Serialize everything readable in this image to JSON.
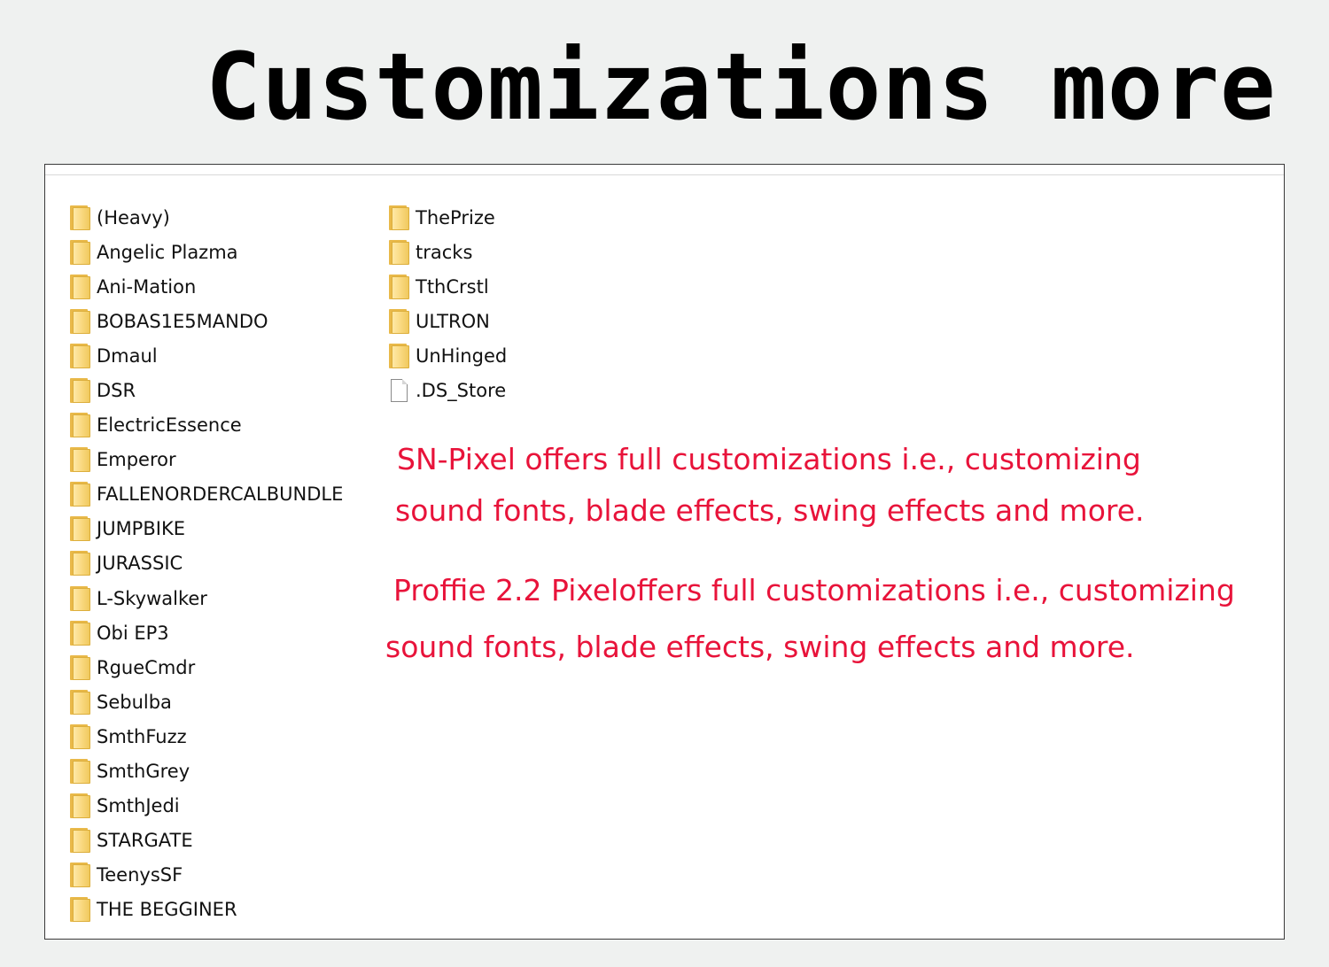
{
  "headline": "Customizations more",
  "colors": {
    "background": "#eff1f0",
    "window": "#ffffff",
    "note_text": "#e8133a",
    "folder": "#f8d67a"
  },
  "explorer": {
    "column1": [
      {
        "name": "(Heavy)",
        "icon": "folder-icon"
      },
      {
        "name": "Angelic Plazma",
        "icon": "folder-icon"
      },
      {
        "name": "Ani-Mation",
        "icon": "folder-icon"
      },
      {
        "name": "BOBAS1E5MANDO",
        "icon": "folder-icon"
      },
      {
        "name": "Dmaul",
        "icon": "folder-icon"
      },
      {
        "name": "DSR",
        "icon": "folder-icon"
      },
      {
        "name": "ElectricEssence",
        "icon": "folder-icon"
      },
      {
        "name": "Emperor",
        "icon": "folder-icon"
      },
      {
        "name": "FALLENORDERCALBUNDLE",
        "icon": "folder-icon"
      },
      {
        "name": "JUMPBIKE",
        "icon": "folder-icon"
      },
      {
        "name": "JURASSIC",
        "icon": "folder-icon"
      },
      {
        "name": "L-Skywalker",
        "icon": "folder-icon"
      },
      {
        "name": "Obi EP3",
        "icon": "folder-icon"
      },
      {
        "name": "RgueCmdr",
        "icon": "folder-icon"
      },
      {
        "name": "Sebulba",
        "icon": "folder-icon"
      },
      {
        "name": "SmthFuzz",
        "icon": "folder-icon"
      },
      {
        "name": "SmthGrey",
        "icon": "folder-icon"
      },
      {
        "name": "SmthJedi",
        "icon": "folder-icon"
      },
      {
        "name": "STARGATE",
        "icon": "folder-icon"
      },
      {
        "name": "TeenysSF",
        "icon": "folder-icon"
      },
      {
        "name": "THE BEGGINER",
        "icon": "folder-icon"
      }
    ],
    "column2": [
      {
        "name": "ThePrize",
        "icon": "folder-icon"
      },
      {
        "name": "tracks",
        "icon": "folder-icon"
      },
      {
        "name": "TthCrstl",
        "icon": "folder-icon"
      },
      {
        "name": "ULTRON",
        "icon": "folder-icon"
      },
      {
        "name": "UnHinged",
        "icon": "folder-icon"
      },
      {
        "name": ".DS_Store",
        "icon": "file-icon"
      }
    ]
  },
  "notes": {
    "sn_line1": "SN-Pixel offers full customizations i.e., customizing",
    "sn_line2": "sound fonts, blade effects, swing effects and more.",
    "proffie_line1": "Proffie 2.2 Pixeloffers full customizations i.e., customizing",
    "proffie_line2": "sound fonts, blade effects, swing effects and more."
  }
}
